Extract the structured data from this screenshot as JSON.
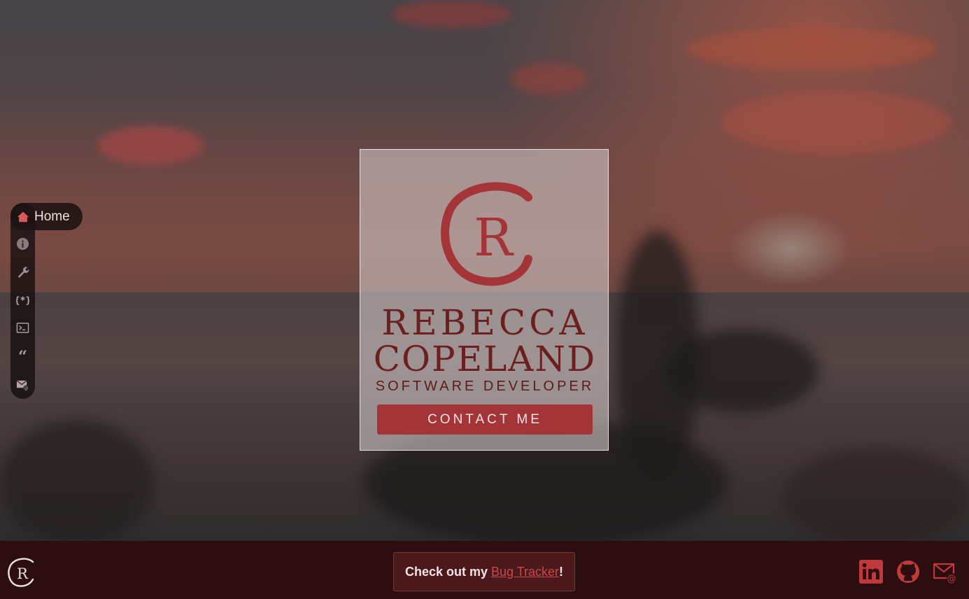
{
  "brand": {
    "first_name": "REBECCA",
    "last_name": "COPELAND",
    "title": "SOFTWARE DEVELOPER",
    "logo_letter": "R",
    "accent_color": "#a33437",
    "dark_red": "#6b1f1f"
  },
  "hero": {
    "cta_label": "CONTACT ME"
  },
  "nav": {
    "active_label": "Home",
    "items": [
      {
        "icon": "home-icon"
      },
      {
        "icon": "info-icon"
      },
      {
        "icon": "wrench-icon"
      },
      {
        "icon": "code-braces-icon"
      },
      {
        "icon": "terminal-icon"
      },
      {
        "icon": "quote-icon"
      },
      {
        "icon": "mail-at-icon"
      }
    ]
  },
  "footer": {
    "promo_prefix": "Check out my",
    "promo_link": "Bug Tracker",
    "promo_suffix": "!",
    "social": [
      "linkedin-icon",
      "github-icon",
      "mail-at-icon"
    ]
  }
}
